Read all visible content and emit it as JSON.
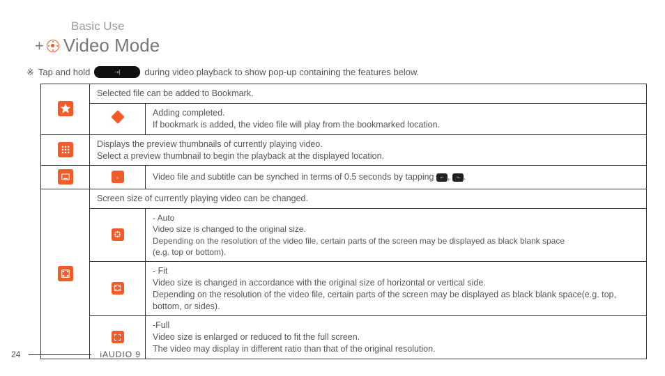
{
  "header": {
    "section": "Basic Use",
    "title": "Video Mode"
  },
  "intro": {
    "mark": "※",
    "before": "Tap and hold",
    "button_glyph": "⇢|",
    "after": "during video playback to show pop-up containing the features below."
  },
  "rows": {
    "bookmark": {
      "desc": "Selected file can be added to Bookmark.",
      "sub_desc": "Adding completed.\nIf bookmark is added, the video file will play from the bookmarked location."
    },
    "thumbnails": {
      "desc": "Displays the preview thumbnails of currently playing video.\nSelect a preview thumbnail to begin the playback at the displayed location."
    },
    "sync": {
      "before": "Video file and subtitle can be synched in terms of 0.5 seconds by tapping ",
      "sep": ", ",
      "after": "."
    },
    "screen": {
      "desc": "Screen size of currently playing video can be changed.",
      "auto": "- Auto\nVideo size is changed to the original size.\nDepending on the resolution of the video file, certain parts of the screen may be displayed as black blank space\n(e.g. top or bottom).",
      "fit": "- Fit\nVideo size is changed in accordance with the original size of horizontal or vertical side.\nDepending on the resolution of the video file, certain parts of the screen may be displayed as black blank space(e.g. top, bottom, or sides).",
      "full": "-Full\nVideo size is enlarged or reduced to fit the full screen.\nThe video may display in different ratio than that of the original resolution."
    }
  },
  "footer": {
    "page": "24",
    "brand": "iAUDIO 9"
  }
}
